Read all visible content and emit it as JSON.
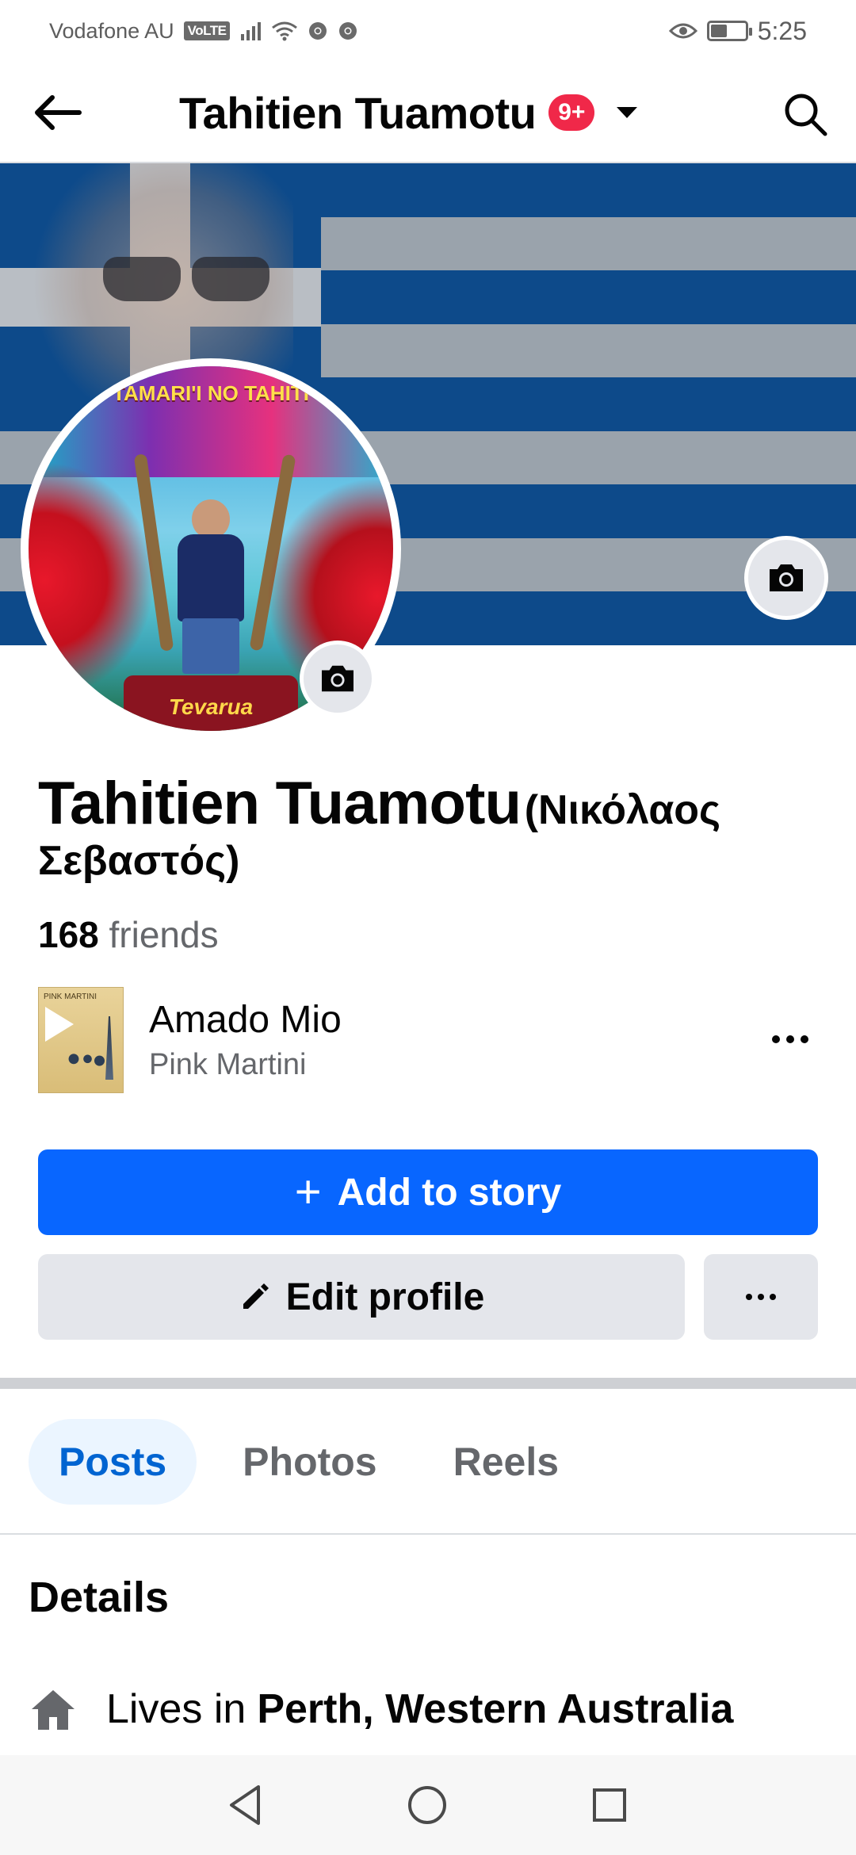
{
  "status_bar": {
    "carrier": "Vodafone AU",
    "volte": "VoLTE",
    "time": "5:25",
    "battery_level": 0.45
  },
  "header": {
    "title": "Tahitien Tuamotu",
    "badge": "9+"
  },
  "avatar_art": {
    "top_text": "TAMARI'I NO TAHITI",
    "bottom_text": "Tevarua"
  },
  "profile": {
    "name": "Tahitien Tuamotu",
    "alt_name": "(Νικόλαος Σεβαστός)",
    "friends_count": "168",
    "friends_label": "friends"
  },
  "music": {
    "song": "Amado Mio",
    "artist": "Pink Martini",
    "album_text": "PINK MARTINI"
  },
  "actions": {
    "add_story": "Add to story",
    "edit_profile": "Edit profile"
  },
  "tabs": [
    {
      "label": "Posts",
      "active": true
    },
    {
      "label": "Photos",
      "active": false
    },
    {
      "label": "Reels",
      "active": false
    }
  ],
  "details": {
    "title": "Details",
    "lives_prefix": "Lives in",
    "lives_place": "Perth, Western Australia"
  },
  "colors": {
    "accent": "#0866ff",
    "badge": "#f02849",
    "tab_active_bg": "#ebf5ff",
    "tab_active_text": "#0064d1"
  },
  "icons": {
    "back": "arrow-left-icon",
    "search": "search-icon",
    "camera": "camera-icon",
    "more": "more-horizontal-icon",
    "edit": "pencil-icon",
    "home": "home-icon"
  }
}
